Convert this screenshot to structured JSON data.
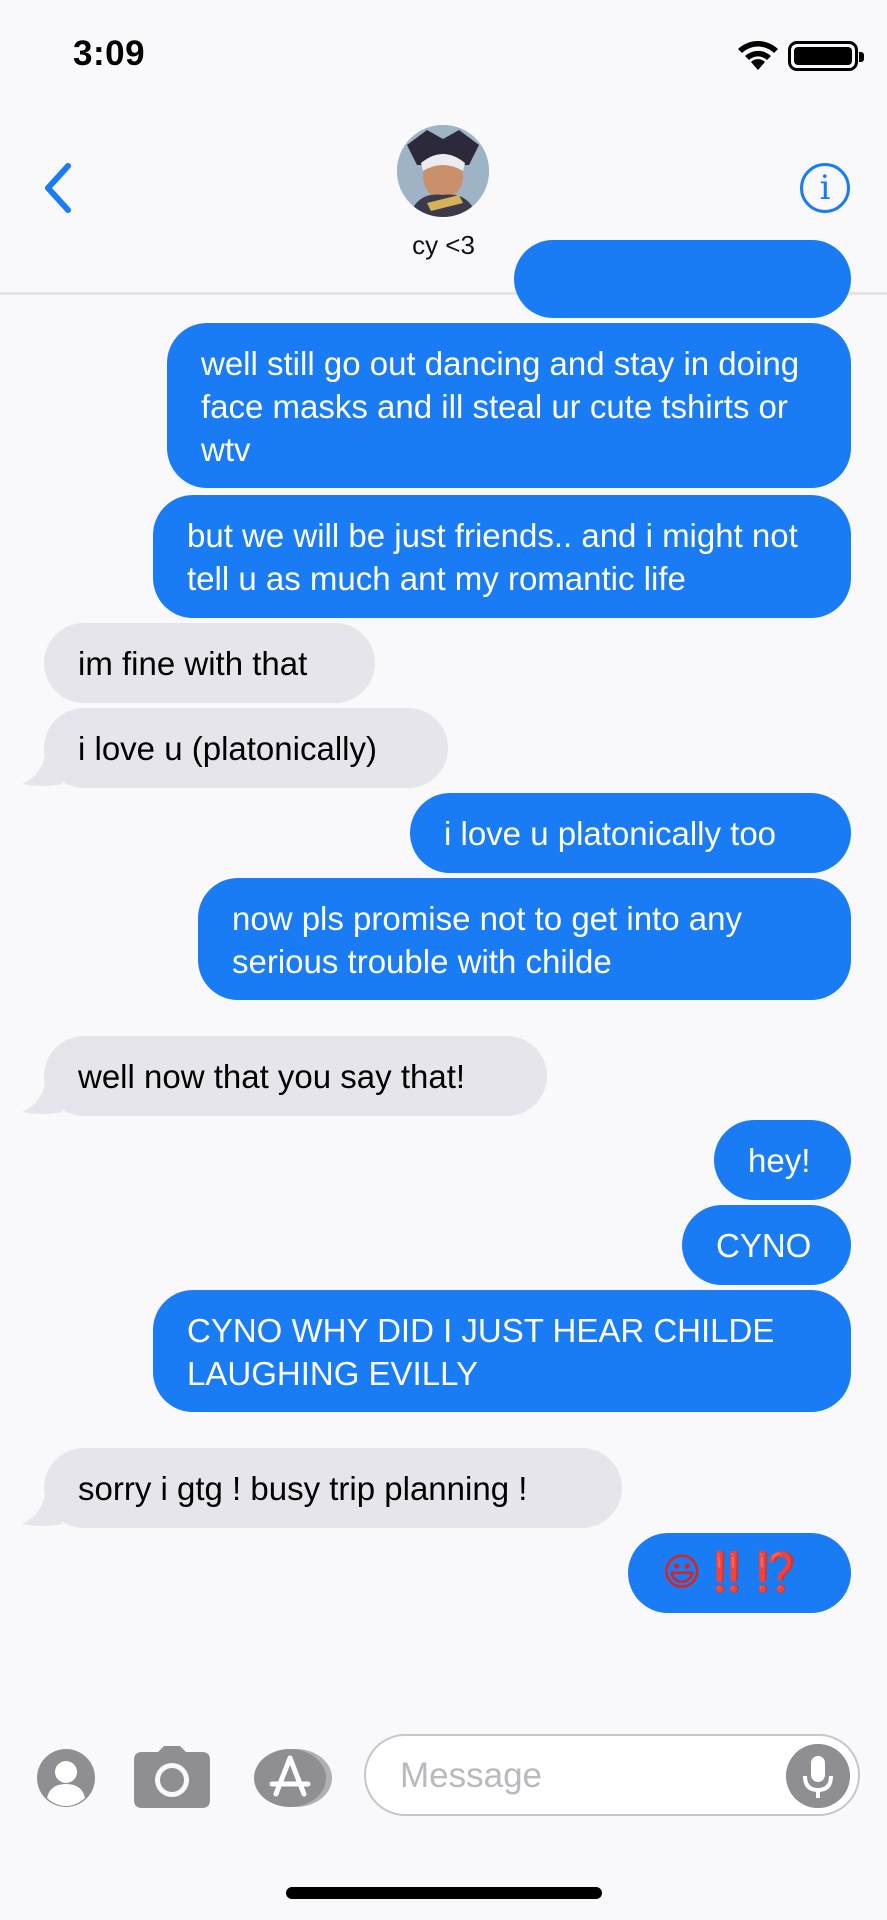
{
  "status_bar": {
    "time": "3:09"
  },
  "header": {
    "contact_name": "cy <3"
  },
  "messages": [
    {
      "from": "me",
      "text": "well still go out dancing and stay in doing face masks and ill steal ur cute tshirts or wtv"
    },
    {
      "from": "me",
      "text": "but we will be just friends.. and i might not tell u as much ant my romantic life"
    },
    {
      "from": "them",
      "text": "im fine with that"
    },
    {
      "from": "them",
      "text": "i love u (platonically)"
    },
    {
      "from": "me",
      "text": "i love u platonically too"
    },
    {
      "from": "me",
      "text": "now pls promise not to get into any serious trouble with childe"
    },
    {
      "from": "them",
      "text": "well now that you say that!"
    },
    {
      "from": "me",
      "text": "hey!"
    },
    {
      "from": "me",
      "text": "CYNO"
    },
    {
      "from": "me",
      "text": "CYNO WHY DID I JUST HEAR CHILDE LAUGHING EVILLY"
    },
    {
      "from": "them",
      "text": "sorry i gtg ! busy trip planning !"
    },
    {
      "from": "me",
      "text": "😃‼️⁉️"
    }
  ],
  "input": {
    "placeholder": "Message"
  },
  "icons": {
    "back": "chevron-left-icon",
    "info": "info-icon",
    "contact": "contact-icon",
    "camera": "camera-icon",
    "apps": "app-store-icon",
    "mic": "microphone-icon"
  },
  "colors": {
    "accent": "#1a7cf5",
    "incoming_bubble": "#e6e5eb",
    "background": "#f9f9fb"
  }
}
